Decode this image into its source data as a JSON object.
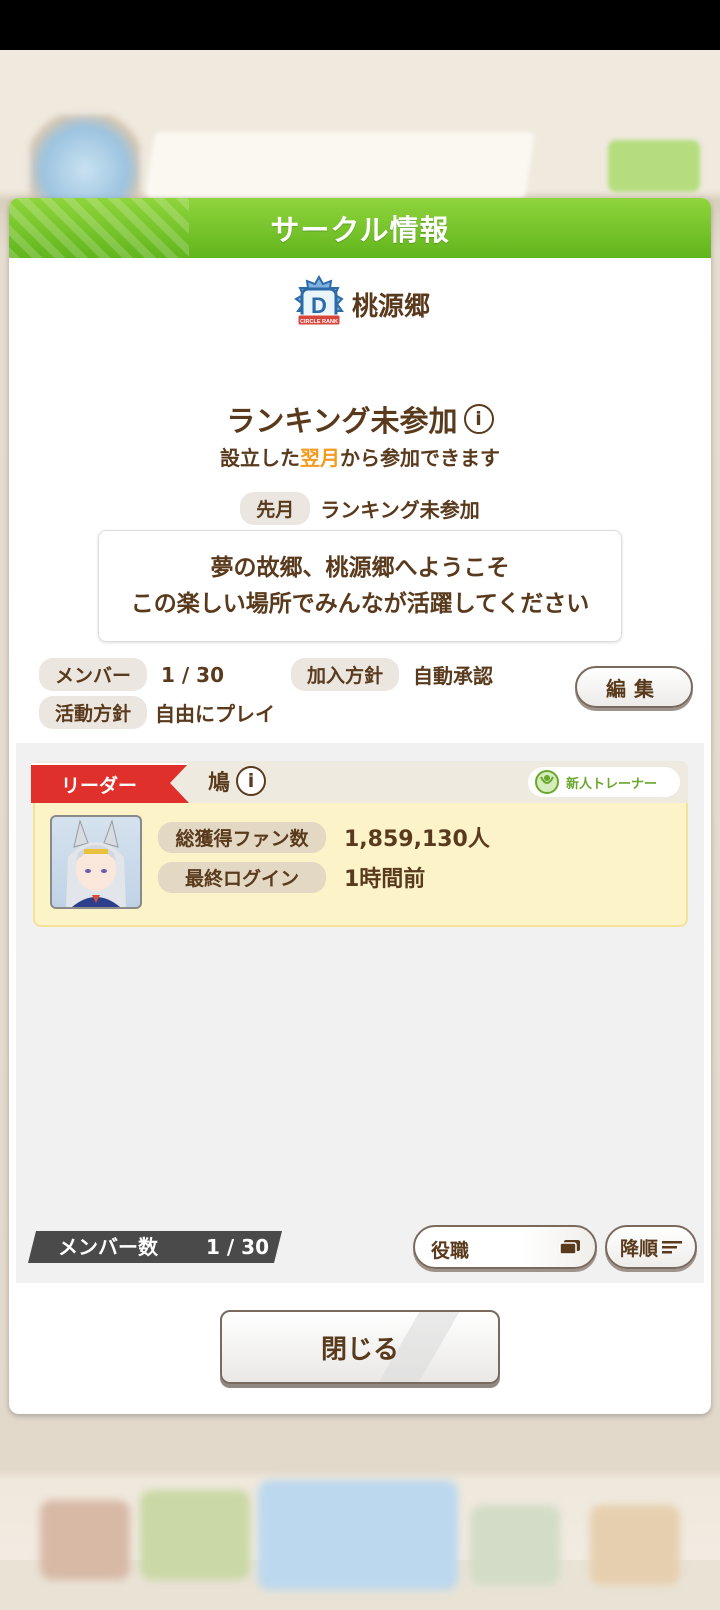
{
  "dialog": {
    "title": "サークル情報",
    "circle_name": "桃源郷",
    "rank_badge_letter": "D",
    "rank_badge_caption": "CIRCLE RANK",
    "ranking_status": "ランキング未参加",
    "ranking_note_prefix": "設立した",
    "ranking_note_highlight": "翌月",
    "ranking_note_suffix": "から参加できます",
    "last_month_label": "先月",
    "last_month_value": "ランキング未参加",
    "welcome_line1": "夢の故郷、桃源郷へようこそ",
    "welcome_line2": "この楽しい場所でみんなが活躍してください",
    "stats": {
      "members_label": "メンバー",
      "members_value": "1 / 30",
      "join_policy_label": "加入方針",
      "join_policy_value": "自動承認",
      "activity_label": "活動方針",
      "activity_value": "自由にプレイ"
    },
    "edit_button": "編集",
    "leader_card": {
      "tag": "リーダー",
      "name": "鳩",
      "trainer_rank": "新人トレーナー",
      "fans_label": "総獲得ファン数",
      "fans_value": "1,859,130人",
      "login_label": "最終ログイン",
      "login_value": "1時間前"
    },
    "member_count_label": "メンバー数",
    "member_count_value": "1 / 30",
    "sort_field": "役職",
    "sort_order": "降順",
    "close_button": "閉じる"
  },
  "colors": {
    "header_green": "#6cbf22",
    "text_brown": "#5a3a1c",
    "highlight_orange": "#f39a1f",
    "leader_red": "#e0302c",
    "card_yellow": "#fdf3c9"
  }
}
